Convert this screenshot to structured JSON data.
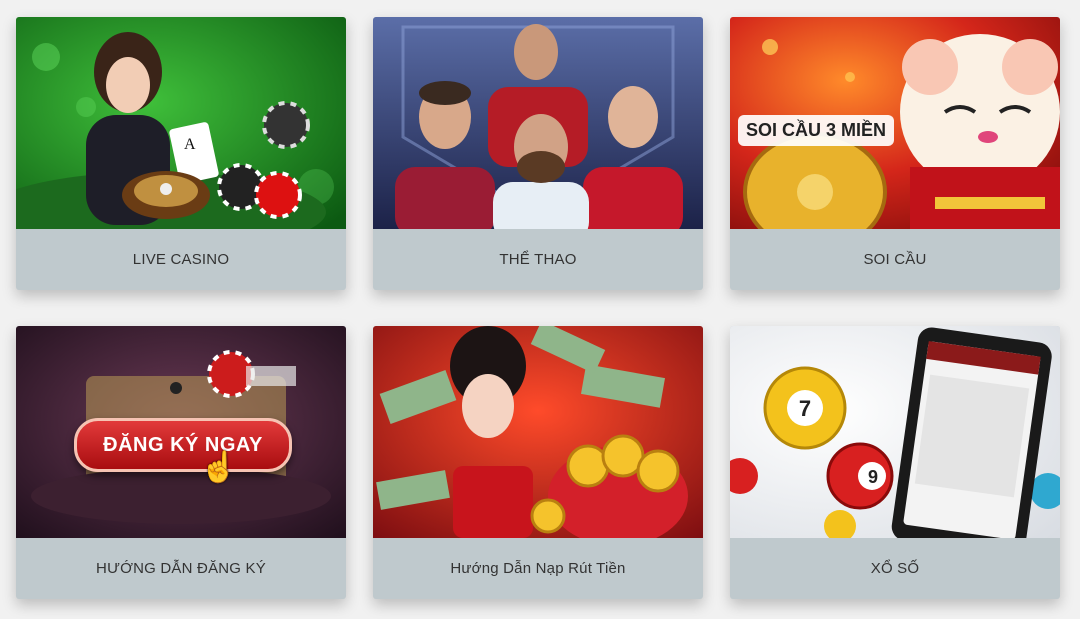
{
  "cards": [
    {
      "label": "LIVE CASINO"
    },
    {
      "label": "THỂ THAO"
    },
    {
      "label": "SOI CẦU",
      "banner": "SOI CẦU 3 MIỀN"
    },
    {
      "label": "HƯỚNG DẪN ĐĂNG KÝ",
      "button": "ĐĂNG KÝ NGAY"
    },
    {
      "label": "Hướng Dẫn Nạp Rút Tiền"
    },
    {
      "label": "XỔ SỐ",
      "balls": [
        "7",
        "9"
      ]
    }
  ]
}
